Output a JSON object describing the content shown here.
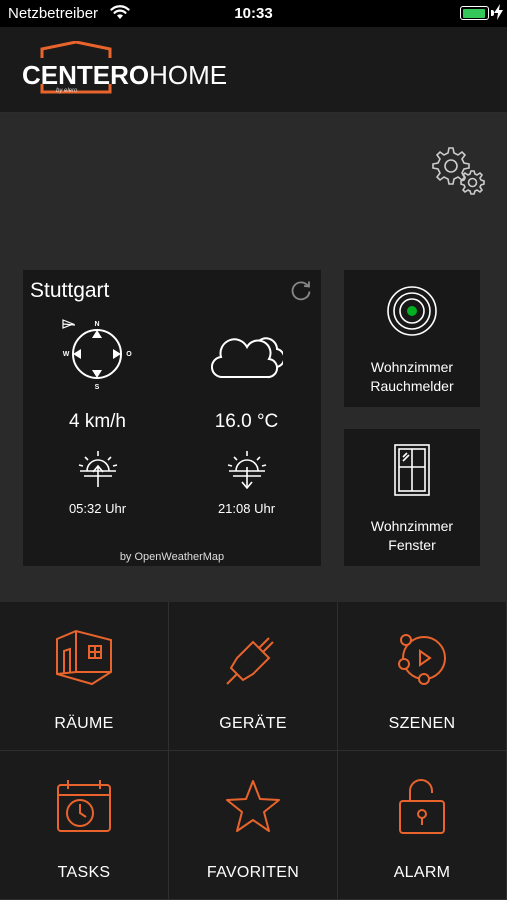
{
  "status_bar": {
    "carrier": "Netzbetreiber",
    "time": "10:33",
    "battery_level": 0.95,
    "battery_color": "#35c759"
  },
  "header": {
    "logo_bold": "CENTERO",
    "logo_light": "HOME",
    "logo_sub": "by elero",
    "accent_color": "#e8642c"
  },
  "weather": {
    "city": "Stuttgart",
    "wind_speed": "4 km/h",
    "temperature": "16.0 °C",
    "sunrise": "05:32 Uhr",
    "sunset": "21:08 Uhr",
    "credit": "by OpenWeatherMap",
    "compass_labels": {
      "north": "N",
      "south": "S",
      "west": "W",
      "east": "O"
    },
    "icons": [
      "compass-icon",
      "cloud-icon",
      "sunrise-icon",
      "sunset-icon",
      "refresh-icon"
    ]
  },
  "devices": [
    {
      "line1": "Wohnzimmer",
      "line2": "Rauchmelder",
      "icon": "smoke-detector-icon",
      "status_color": "#00b020"
    },
    {
      "line1": "Wohnzimmer",
      "line2": "Fenster",
      "icon": "window-icon"
    }
  ],
  "menu": [
    {
      "label": "RÄUME",
      "icon": "rooms-icon"
    },
    {
      "label": "GERÄTE",
      "icon": "plug-icon"
    },
    {
      "label": "SZENEN",
      "icon": "scenes-icon"
    },
    {
      "label": "TASKS",
      "icon": "calendar-clock-icon"
    },
    {
      "label": "FAVORITEN",
      "icon": "star-icon"
    },
    {
      "label": "ALARM",
      "icon": "lock-icon"
    }
  ]
}
